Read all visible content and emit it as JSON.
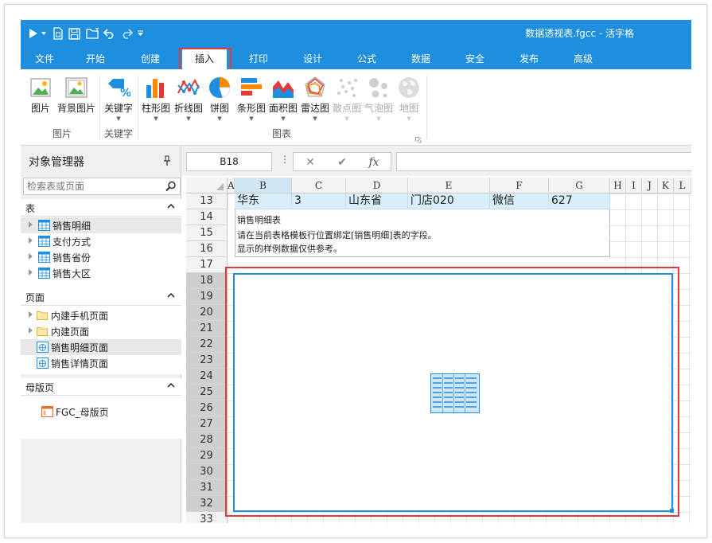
{
  "window": {
    "title": "数据透视表.fgcc - 活字格"
  },
  "quick_access": [
    "play-icon",
    "dropdown-icon",
    "save-as-icon",
    "save-icon",
    "open-folder-icon",
    "undo-icon",
    "redo-icon",
    "customize-icon"
  ],
  "menu": {
    "items": [
      {
        "label": "文件"
      },
      {
        "label": "开始"
      },
      {
        "label": "创建"
      },
      {
        "label": "插入",
        "active": true
      },
      {
        "label": "打印"
      },
      {
        "label": "设计"
      },
      {
        "label": "公式"
      },
      {
        "label": "数据"
      },
      {
        "label": "安全"
      },
      {
        "label": "发布"
      },
      {
        "label": "高级"
      }
    ]
  },
  "ribbon": {
    "groups": [
      {
        "label": "图片",
        "buttons": [
          {
            "label": "图片"
          },
          {
            "label": "背景图片"
          }
        ]
      },
      {
        "label": "关键字",
        "buttons": [
          {
            "label": "关键字"
          }
        ]
      },
      {
        "label": "图表",
        "buttons": [
          {
            "label": "柱形图"
          },
          {
            "label": "折线图"
          },
          {
            "label": "饼图"
          },
          {
            "label": "条形图"
          },
          {
            "label": "面积图"
          },
          {
            "label": "雷达图"
          },
          {
            "label": "散点图",
            "disabled": true
          },
          {
            "label": "气泡图",
            "disabled": true
          },
          {
            "label": "地图",
            "disabled": true
          }
        ]
      }
    ]
  },
  "object_manager": {
    "title": "对象管理器",
    "search_placeholder": "检索表或页面",
    "sections": [
      {
        "title": "表",
        "items": [
          {
            "label": "销售明细",
            "selected": true
          },
          {
            "label": "支付方式"
          },
          {
            "label": "销售省份"
          },
          {
            "label": "销售大区"
          }
        ]
      },
      {
        "title": "页面",
        "items": [
          {
            "label": "内建手机页面"
          },
          {
            "label": "内建页面"
          },
          {
            "label": "销售明细页面",
            "selected": true
          },
          {
            "label": "销售详情页面"
          }
        ]
      },
      {
        "title": "母版页",
        "items": [
          {
            "label": "FGC_母版页"
          }
        ]
      }
    ]
  },
  "formula_bar": {
    "name_box": "B18",
    "value": ""
  },
  "sheet": {
    "columns": [
      "A",
      "B",
      "C",
      "D",
      "E",
      "F",
      "G",
      "H",
      "I",
      "J",
      "K",
      "L"
    ],
    "rows": [
      "13",
      "14",
      "15",
      "16",
      "17",
      "18",
      "19",
      "20",
      "21",
      "22",
      "23",
      "24",
      "25",
      "26",
      "27",
      "28",
      "29",
      "30",
      "31",
      "32",
      "33"
    ],
    "row13": [
      "华东",
      "3",
      "山东省",
      "门店020",
      "微信",
      "627"
    ],
    "notes": [
      "销售明细表",
      "请在当前表格模板行位置绑定[销售明细]表的字段。",
      "显示的样例数据仅供参考。"
    ]
  }
}
